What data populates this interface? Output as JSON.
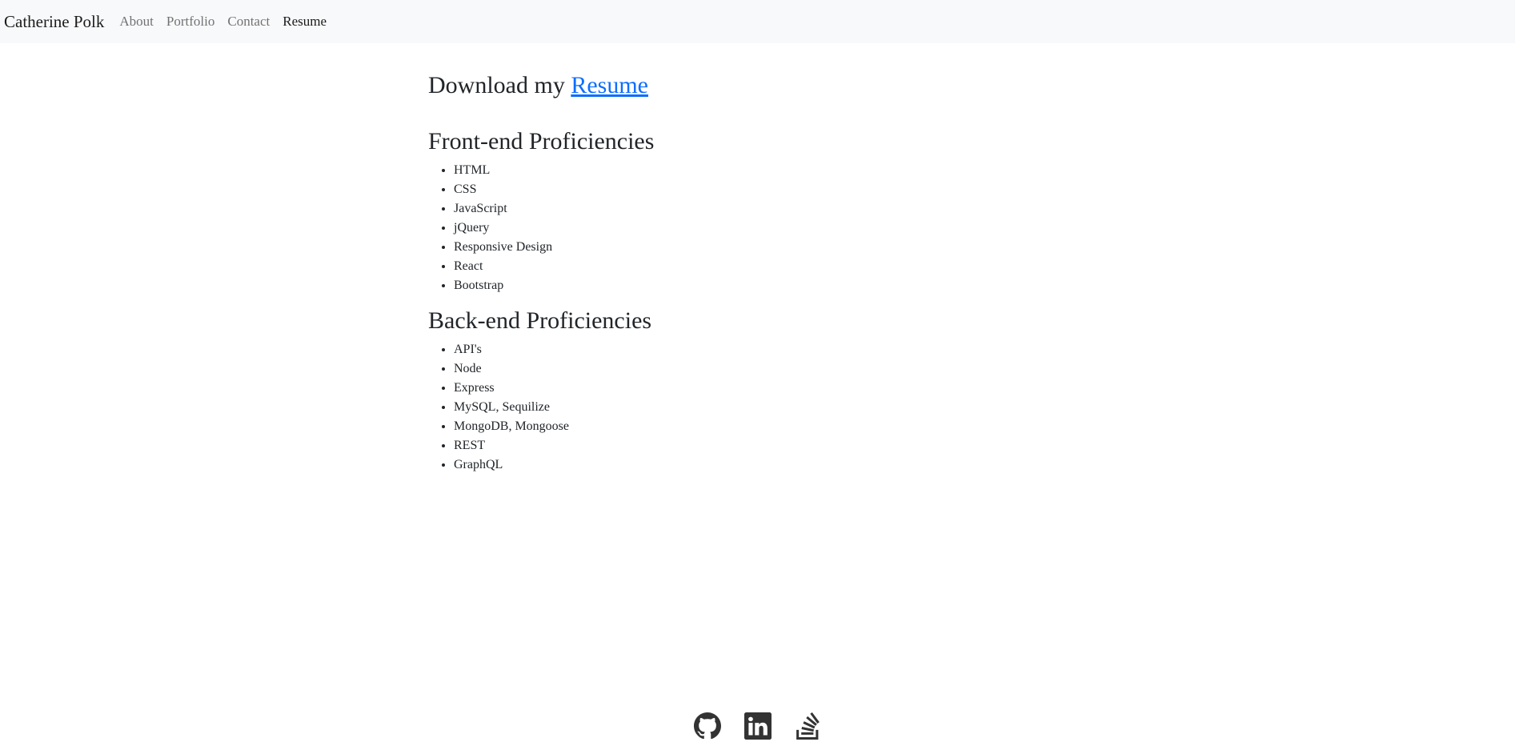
{
  "navbar": {
    "brand": "Catherine Polk",
    "links": [
      {
        "label": "About"
      },
      {
        "label": "Portfolio"
      },
      {
        "label": "Contact"
      },
      {
        "label": "Resume"
      }
    ],
    "active": "Resume"
  },
  "main": {
    "download_prefix": "Download my ",
    "download_link": "Resume",
    "frontend": {
      "title": "Front-end Proficiencies",
      "items": [
        "HTML",
        "CSS",
        "JavaScript",
        "jQuery",
        "Responsive Design",
        "React",
        "Bootstrap"
      ]
    },
    "backend": {
      "title": "Back-end Proficiencies",
      "items": [
        "API's",
        "Node",
        "Express",
        "MySQL, Sequilize",
        "MongoDB, Mongoose",
        "REST",
        "GraphQL"
      ]
    }
  },
  "footer": {
    "icons": [
      "github-icon",
      "linkedin-icon",
      "stackoverflow-icon"
    ]
  },
  "colors": {
    "navbar_bg": "#f8f9fa",
    "link": "#0d6efd",
    "icon": "#333333"
  }
}
